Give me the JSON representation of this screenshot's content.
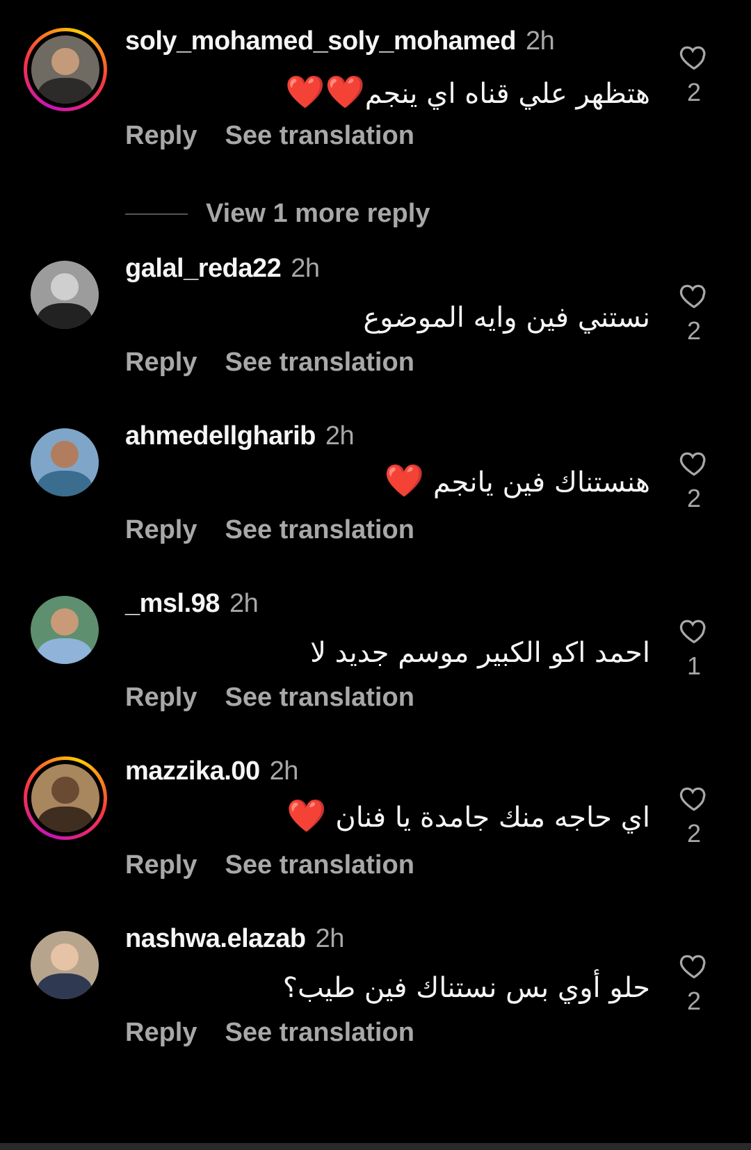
{
  "comments": [
    {
      "username": "soly_mohamed_soly_mohamed",
      "time": "2h",
      "text": "هتظهر علي قناه اي ينجم",
      "hearts": "❤️❤️",
      "likes": "2",
      "reply": "Reply",
      "translate": "See translation",
      "avatar_ring": true,
      "avatar_colors": [
        "#6f6a62",
        "#c39b7a",
        "#2d2b2a"
      ]
    },
    {
      "username": "galal_reda22",
      "time": "2h",
      "text": "نستني فين وايه الموضوع",
      "hearts": "",
      "likes": "2",
      "reply": "Reply",
      "translate": "See translation",
      "avatar_ring": false,
      "avatar_colors": [
        "#9c9c9c",
        "#cfcfcf",
        "#222222"
      ]
    },
    {
      "username": "ahmedellgharib",
      "time": "2h",
      "text": "هنستناك فين يانجم",
      "hearts": "❤️",
      "likes": "2",
      "reply": "Reply",
      "translate": "See translation",
      "avatar_ring": false,
      "avatar_colors": [
        "#7fa6c8",
        "#b27d5e",
        "#3b6d8e"
      ]
    },
    {
      "username": "_msl.98",
      "time": "2h",
      "text": "احمد اكو الكبير موسم جديد لا",
      "hearts": "",
      "likes": "1",
      "reply": "Reply",
      "translate": "See translation",
      "avatar_ring": false,
      "avatar_colors": [
        "#5e8f6e",
        "#c99a78",
        "#8fb3d9"
      ]
    },
    {
      "username": "mazzika.00",
      "time": "2h",
      "text": "اي حاجه منك جامدة يا فنان",
      "hearts": "❤️",
      "likes": "2",
      "reply": "Reply",
      "translate": "See translation",
      "avatar_ring": true,
      "avatar_colors": [
        "#a8875f",
        "#6a4a33",
        "#3f2d20"
      ]
    },
    {
      "username": "nashwa.elazab",
      "time": "2h",
      "text": "حلو أوي بس نستناك فين طيب؟",
      "hearts": "",
      "likes": "2",
      "reply": "Reply",
      "translate": "See translation",
      "avatar_ring": false,
      "avatar_colors": [
        "#b7a48c",
        "#e6c2a6",
        "#2f3a52"
      ]
    }
  ],
  "view_more": "View 1 more reply",
  "colors": {
    "background": "#000000",
    "text": "#f5f5f5",
    "muted": "#a8a8a8",
    "heart": "#ff2a2a"
  }
}
